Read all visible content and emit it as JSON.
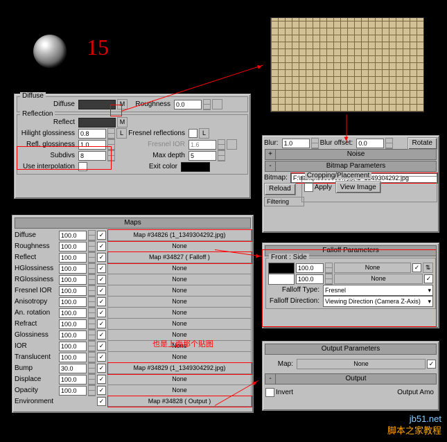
{
  "number_label": "15",
  "diffuse_panel": {
    "title": "Diffuse",
    "diffuse_label": "Diffuse",
    "roughness_label": "Roughness",
    "roughness_value": "0.0",
    "m": "M"
  },
  "reflection_panel": {
    "title": "Reflection",
    "reflect_label": "Reflect",
    "m": "M",
    "hilight_label": "Hilight glossiness",
    "hilight_value": "0.8",
    "refl_gloss_label": "Refl. glossiness",
    "refl_gloss_value": "1.0",
    "l": "L",
    "fresnel_refl_label": "Fresnel reflections",
    "fresnel_ior_label": "Fresnel IOR",
    "fresnel_ior_value": "1.6",
    "subdivs_label": "Subdivs",
    "subdivs_value": "8",
    "max_depth_label": "Max depth",
    "max_depth_value": "5",
    "use_interp_label": "Use interpolation",
    "exit_color_label": "Exit color"
  },
  "maps": {
    "title": "Maps",
    "rows": [
      {
        "name": "Diffuse",
        "val": "100.0",
        "map": "Map #34826 (1_1349304292.jpg)",
        "red": true
      },
      {
        "name": "Roughness",
        "val": "100.0",
        "map": "None"
      },
      {
        "name": "Reflect",
        "val": "100.0",
        "map": "Map #34827  ( Falloff )",
        "red": true
      },
      {
        "name": "HGlossiness",
        "val": "100.0",
        "map": "None"
      },
      {
        "name": "RGlossiness",
        "val": "100.0",
        "map": "None"
      },
      {
        "name": "Fresnel IOR",
        "val": "100.0",
        "map": "None"
      },
      {
        "name": "Anisotropy",
        "val": "100.0",
        "map": "None"
      },
      {
        "name": "An. rotation",
        "val": "100.0",
        "map": "None"
      },
      {
        "name": "Refract",
        "val": "100.0",
        "map": "None"
      },
      {
        "name": "Glossiness",
        "val": "100.0",
        "map": "None"
      },
      {
        "name": "IOR",
        "val": "100.0",
        "map": "None"
      },
      {
        "name": "Translucent",
        "val": "100.0",
        "map": "None"
      },
      {
        "name": "Bump",
        "val": "30.0",
        "map": "Map #34829 (1_1349304292.jpg)",
        "red": true
      },
      {
        "name": "Displace",
        "val": "100.0",
        "map": "None"
      },
      {
        "name": "Opacity",
        "val": "100.0",
        "map": "None"
      },
      {
        "name": "Environment",
        "val": "",
        "map": "Map #34828  ( Output )",
        "red": true
      }
    ]
  },
  "bitmap_coords": {
    "blur_label": "Blur:",
    "blur_value": "1.0",
    "blur_off_label": "Blur offset:",
    "blur_off_value": "0.0",
    "rotate": "Rotate",
    "noise": "Noise",
    "bitmap_params": "Bitmap Parameters",
    "bitmap_label": "Bitmap:",
    "bitmap_path": "F:\\tianqi\\0000000\\材质\\1_1349304292.jpg",
    "reload": "Reload",
    "crop_title": "Cropping/Placement",
    "apply": "Apply",
    "view_image": "View Image",
    "filtering": "Filtering",
    "plus": "+",
    "minus": "-"
  },
  "falloff": {
    "title": "Falloff Parameters",
    "front_side": "Front : Side",
    "v1": "100.0",
    "v2": "100.0",
    "none": "None",
    "falloff_type_label": "Falloff Type:",
    "falloff_type_value": "Fresnel",
    "falloff_dir_label": "Falloff Direction:",
    "falloff_dir_value": "Viewing Direction (Camera Z-Axis)"
  },
  "output": {
    "output_params": "Output Parameters",
    "map_label": "Map:",
    "none": "None",
    "output_title": "Output",
    "invert": "Invert",
    "output_amount": "Output Amo"
  },
  "annotation": "也是上面那个贴图",
  "watermark1": "jb51.net",
  "watermark2": "脚本之家教程"
}
